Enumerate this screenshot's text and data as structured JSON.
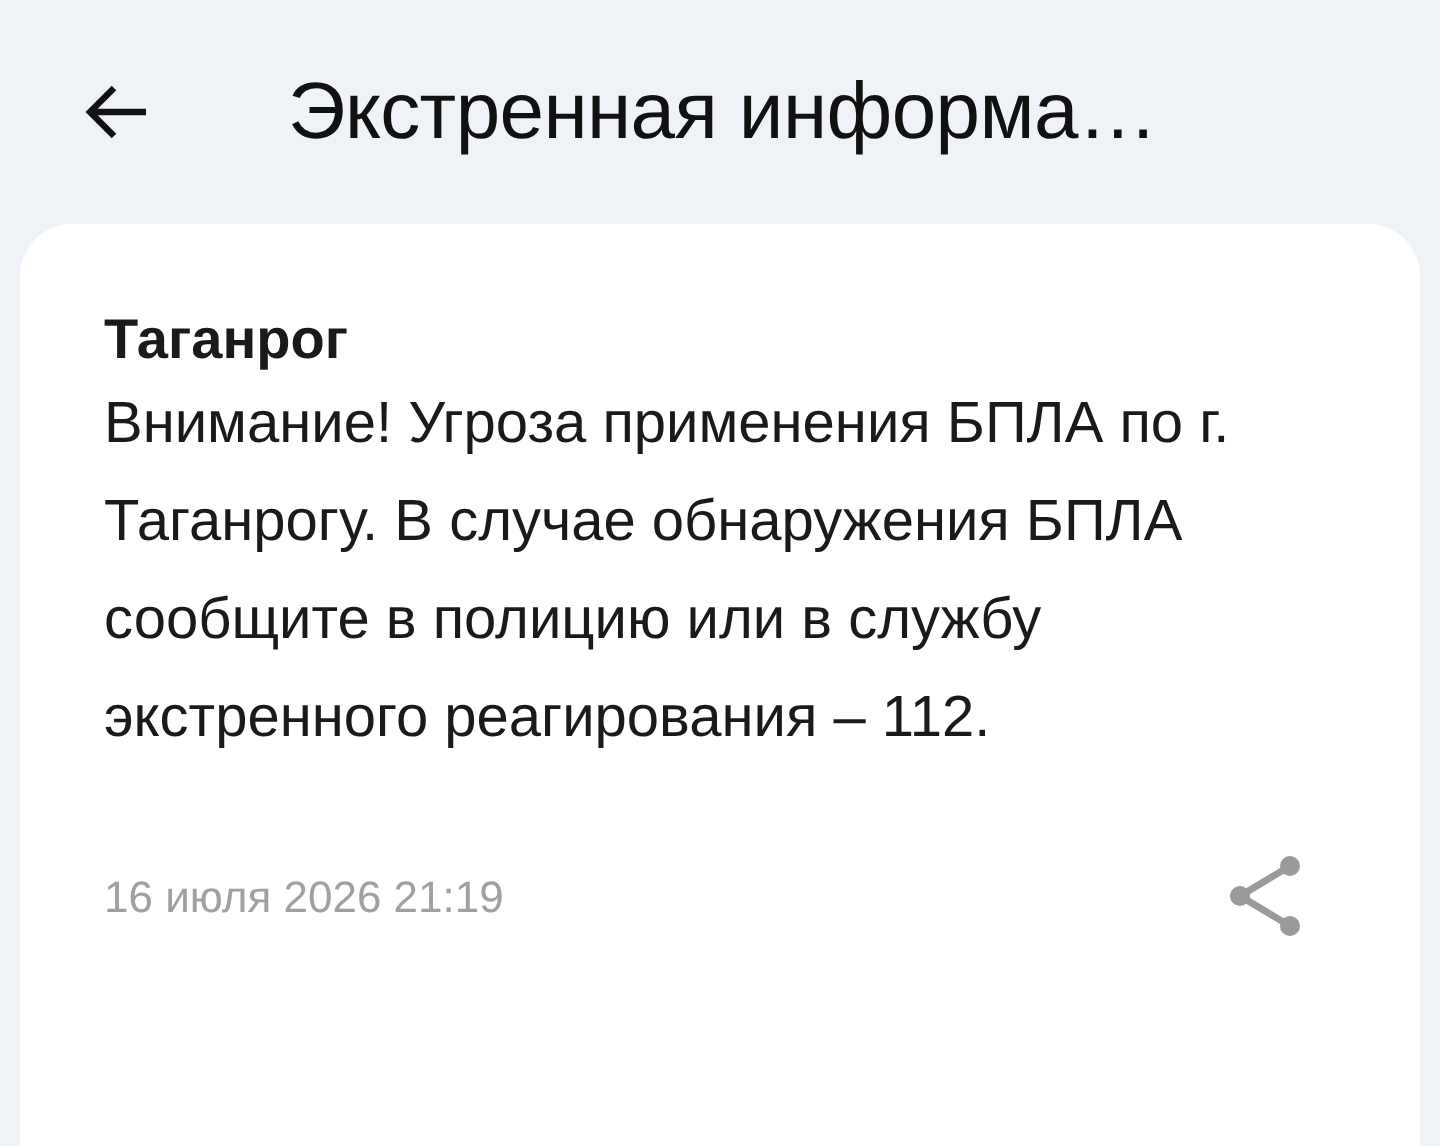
{
  "header": {
    "title": "Экстренная информа…"
  },
  "message": {
    "city": "Таганрог",
    "text": "Внимание! Угроза применения БПЛА по г. Таганрогу. В случае обнаружения БПЛА сообщите в полицию или в службу экстренного реагирования – 112.",
    "date": "16 июля 2026 21:19"
  }
}
